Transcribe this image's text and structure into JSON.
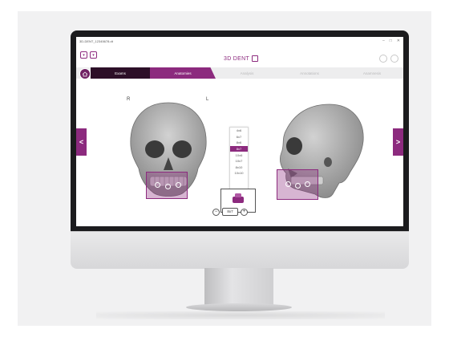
{
  "window": {
    "file_label": "3D-DENT_12345678.dt",
    "controls": [
      "–",
      "□",
      "✕"
    ]
  },
  "toolbar": {
    "brand": "3D DENT",
    "left_buttons": [
      "▾",
      "▾"
    ]
  },
  "tabs": [
    {
      "label": "Exams",
      "state": "done"
    },
    {
      "label": "Anatomies",
      "state": "active"
    },
    {
      "label": "Analysis",
      "state": "disabled"
    },
    {
      "label": "Annotations",
      "state": "disabled"
    },
    {
      "label": "Anamnesis",
      "state": "disabled"
    }
  ],
  "nav": {
    "prev": "<",
    "next": ">"
  },
  "view_labels": {
    "right": "R",
    "left": "L"
  },
  "sizes": {
    "items": [
      "4x6",
      "6x7",
      "8x6",
      "8x7",
      "10x6",
      "10x7",
      "8x10",
      "10x10"
    ],
    "selected": "8x7"
  },
  "stepper": {
    "minus": "−",
    "value": "8x7",
    "plus": "+"
  },
  "colors": {
    "accent": "#8c2a7e",
    "dark_tab": "#2d0f28",
    "selection_fill": "#b58ac4"
  }
}
